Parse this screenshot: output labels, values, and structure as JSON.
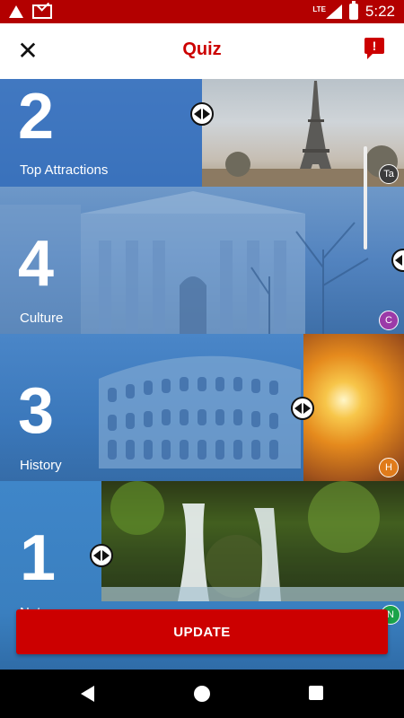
{
  "status_bar": {
    "time": "5:22",
    "network": "LTE",
    "icons": [
      "warning-icon",
      "mail-icon",
      "signal-icon",
      "battery-icon"
    ]
  },
  "app_bar": {
    "title": "Quiz",
    "close_icon": "close-icon",
    "report_icon": "feedback-icon",
    "report_glyph": "!"
  },
  "rows": [
    {
      "rank": "2",
      "label": "Top Attractions",
      "badge": "Ta",
      "badge_color": "#3c3c3c"
    },
    {
      "rank": "4",
      "label": "Culture",
      "badge": "C",
      "badge_color": "#9b3aa8"
    },
    {
      "rank": "3",
      "label": "History",
      "badge": "H",
      "badge_color": "#e07b1a"
    },
    {
      "rank": "1",
      "label": "Nature",
      "badge": "N",
      "badge_color": "#1aa34a"
    }
  ],
  "update_button": {
    "label": "UPDATE"
  },
  "colors": {
    "brand_red": "#cc0000",
    "overlay_blue": "#2e6ec8"
  }
}
